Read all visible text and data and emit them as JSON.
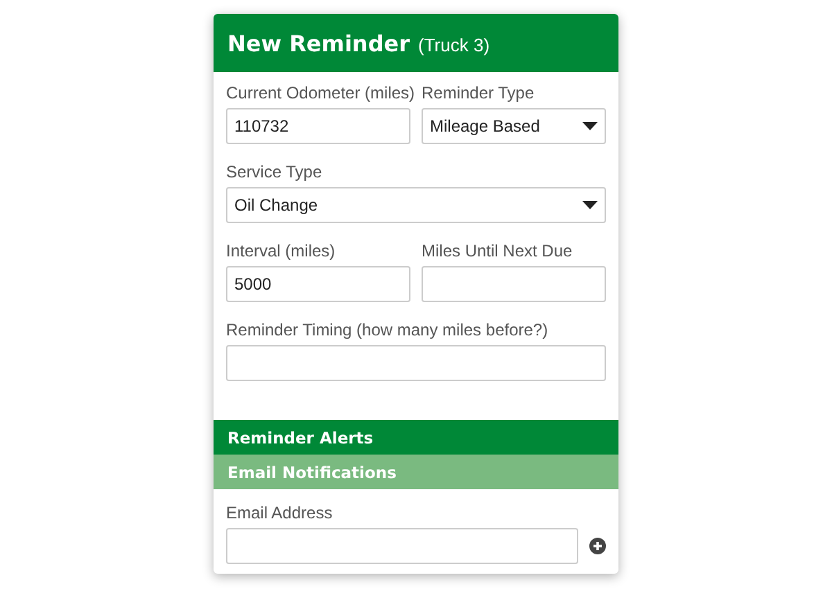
{
  "header": {
    "title": "New Reminder",
    "subtitle": "(Truck 3)"
  },
  "rows": [
    [
      {
        "label": "Current Odometer (miles)",
        "kind": "text",
        "value": "110732"
      },
      {
        "label": "Reminder Type",
        "kind": "select",
        "value": "Mileage Based"
      }
    ],
    [
      {
        "label": "Service Type",
        "kind": "select",
        "value": "Oil Change"
      }
    ],
    [
      {
        "label": "Interval (miles)",
        "kind": "text",
        "value": "5000"
      },
      {
        "label": "Miles Until Next Due",
        "kind": "text"
      }
    ],
    [
      {
        "label": "Reminder Timing (how many miles before?)",
        "kind": "text"
      }
    ]
  ],
  "sections": [
    {
      "title": "Reminder Alerts",
      "kind": "primary"
    },
    {
      "title": "Email Notifications",
      "kind": "secondary"
    }
  ],
  "email": {
    "label": "Email Address"
  }
}
